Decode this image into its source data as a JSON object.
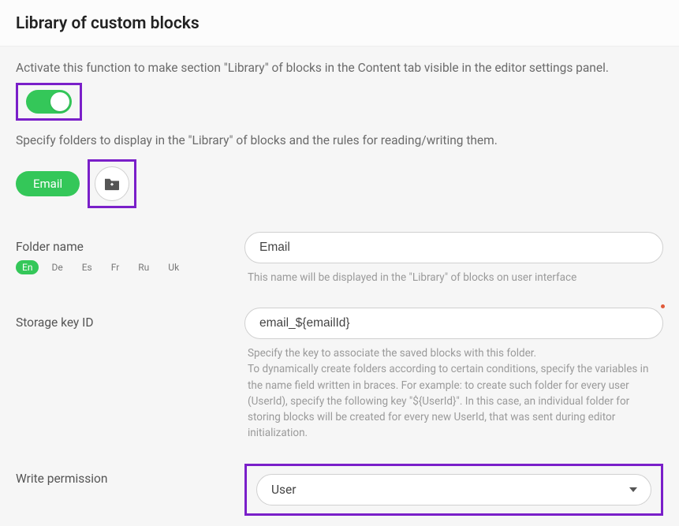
{
  "header": {
    "title": "Library of custom blocks"
  },
  "section1": {
    "desc": "Activate this function to make section \"Library\" of blocks in the Content tab visible in the editor settings panel.",
    "toggle_on": true
  },
  "section2": {
    "desc": "Specify folders to display in the \"Library\" of blocks and the rules for reading/writing them.",
    "chip_label": "Email"
  },
  "folder_name": {
    "label": "Folder name",
    "value": "Email",
    "hint": "This name will be displayed in the \"Library\" of blocks on user interface",
    "langs": [
      "En",
      "De",
      "Es",
      "Fr",
      "Ru",
      "Uk"
    ],
    "active_lang_index": 0
  },
  "storage_key": {
    "label": "Storage key ID",
    "value": "email_${emailId}",
    "hint": "Specify the key to associate the saved blocks with this folder.\nTo dynamically create folders according to certain conditions, specify the variables in the name field written in braces. For example: to create such folder for every user (UserId), specify the following key \"${UserId}\". In this case, an individual folder for storing blocks will be created for every new UserId, that was sent during editor initialization."
  },
  "write_permission": {
    "label": "Write permission",
    "value": "User"
  }
}
